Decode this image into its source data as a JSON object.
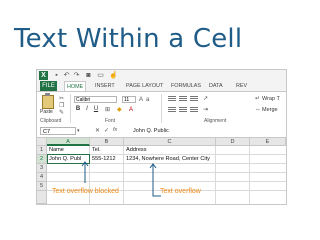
{
  "slide": {
    "title": "Text Within a Cell"
  },
  "colors": {
    "title": "#1f5c87",
    "excel_green": "#217346",
    "annotation": "#f08a17"
  },
  "excel": {
    "quick_access_icons": [
      "excel-logo",
      "save-icon",
      "undo-icon",
      "redo-icon",
      "camera-icon",
      "print-icon",
      "touch-icon"
    ],
    "tabs": [
      "FILE",
      "HOME",
      "INSERT",
      "PAGE LAYOUT",
      "FORMULAS",
      "DATA",
      "REV"
    ],
    "active_tab": "HOME",
    "ribbon": {
      "paste_label": "Paste",
      "font_name": "Calibri",
      "font_size": "11",
      "bold": "B",
      "italic": "I",
      "underline": "U",
      "wrap_label": "Wrap T",
      "merge_label": "Merge",
      "groups": {
        "clipboard": "Clipboard",
        "font": "Font",
        "alignment": "Alignment"
      }
    },
    "formula_bar": {
      "name_box": "C7",
      "fx": "fx",
      "value": "John Q. Public"
    },
    "columns": [
      "A",
      "B",
      "C",
      "D",
      "E"
    ],
    "rows": [
      "1",
      "2",
      "3",
      "4",
      "5"
    ],
    "cells": {
      "A1": "Name",
      "B1": "Tel.",
      "C1": "Address",
      "A2": "John Q. Publ",
      "B2": "555-1212",
      "C2": "1234, Nowhere Road, Center City"
    }
  },
  "annotations": {
    "blocked": "Text overflow blocked",
    "overflow": "Text overflow"
  }
}
